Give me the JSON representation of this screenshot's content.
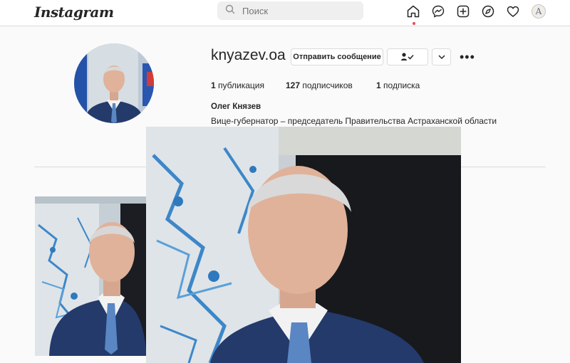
{
  "header": {
    "logo": "Instagram",
    "search_placeholder": "Поиск",
    "nav_icons": [
      "home-icon",
      "messenger-icon",
      "new-post-icon",
      "explore-icon",
      "activity-heart-icon",
      "profile-avatar-icon"
    ],
    "avatar_letter": "A"
  },
  "profile": {
    "username": "knyazev.oa",
    "message_button": "Отправить сообщение",
    "follow_button_icon": "person-check-icon",
    "dropdown_icon": "chevron-down-icon",
    "more_label": "•••",
    "stats": {
      "posts_count": "1",
      "posts_label": "публикация",
      "followers_count": "127",
      "followers_label": "подписчиков",
      "following_count": "1",
      "following_label": "подписка"
    },
    "full_name": "Олег Князев",
    "bio": "Вице-губернатор – председатель Правительства Астраханской области"
  },
  "colors": {
    "accent_dot": "#ed4956",
    "border": "#dbdbdb",
    "suit": "#233a6b",
    "tie": "#5a86c3"
  }
}
